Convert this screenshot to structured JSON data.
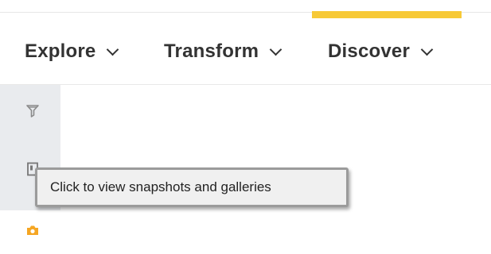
{
  "menu": {
    "items": [
      {
        "label": "Explore"
      },
      {
        "label": "Transform"
      },
      {
        "label": "Discover"
      }
    ],
    "active_index": 2,
    "accent_color": "#f7c936"
  },
  "sidebar": {
    "items": [
      {
        "icon": "funnel-icon"
      },
      {
        "icon": "document-icon"
      },
      {
        "icon": "camera-icon",
        "active": true,
        "color": "#f5a623"
      }
    ]
  },
  "tooltip": {
    "text": "Click to view snapshots and galleries"
  }
}
